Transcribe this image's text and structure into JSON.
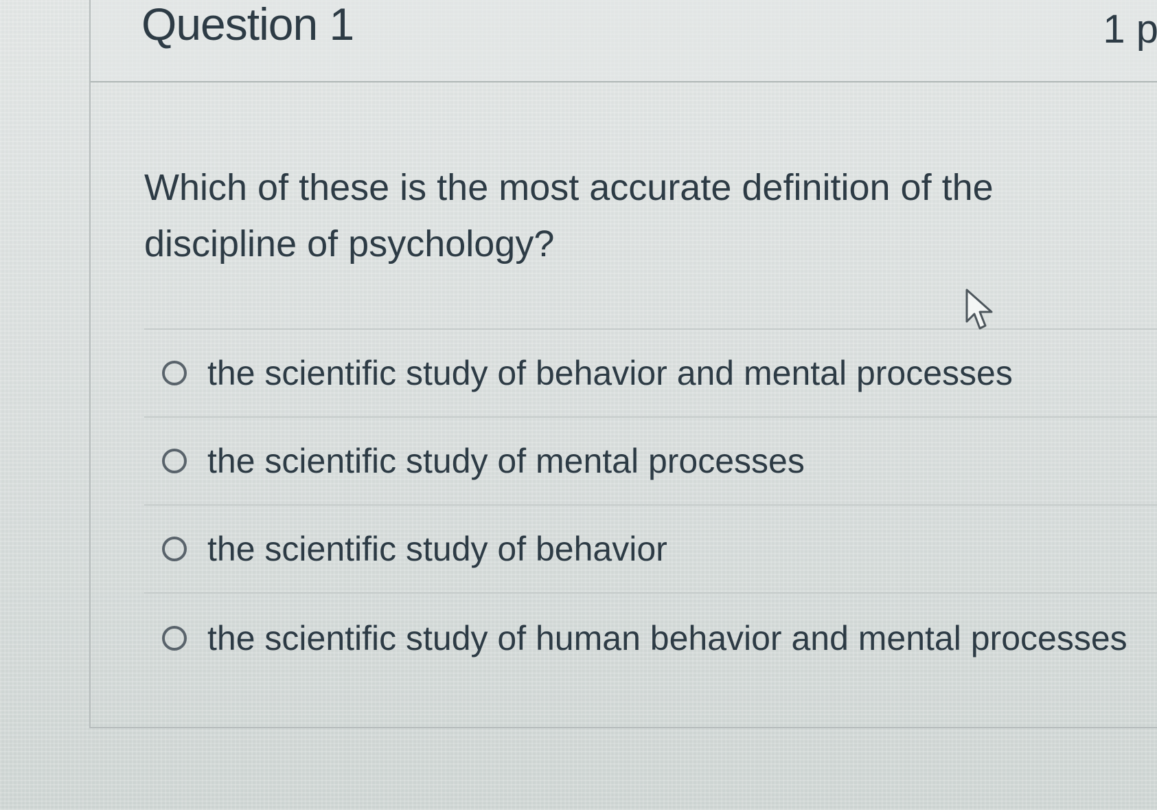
{
  "question": {
    "title": "Question 1",
    "points": "1 p",
    "text": "Which of these is the most accurate definition of the discipline of psychology?",
    "answers": [
      {
        "label": "the scientific study of behavior and mental processes",
        "selected": false
      },
      {
        "label": "the scientific study of mental processes",
        "selected": false
      },
      {
        "label": "the scientific study of behavior",
        "selected": false
      },
      {
        "label": "the scientific study of human behavior and mental processes",
        "selected": false
      }
    ]
  },
  "icons": {
    "pointer": "mouse-pointer-icon",
    "radio": "radio-unchecked-icon"
  },
  "colors": {
    "text": "#2d3b45",
    "radio_border": "#59636b",
    "divider": "#c6cccb"
  }
}
